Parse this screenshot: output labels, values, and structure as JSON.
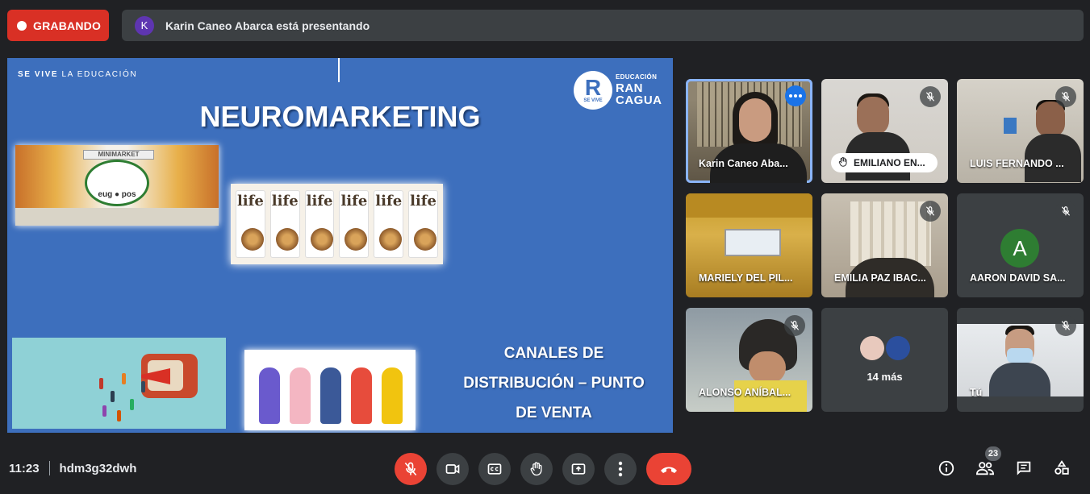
{
  "recording": {
    "label": "GRABANDO"
  },
  "presenter": {
    "initial": "K",
    "text": "Karin Caneo Abarca está presentando"
  },
  "slide": {
    "tagline_bold": "SE VIVE",
    "tagline_rest": " LA EDUCACIÓN",
    "title": "NEUROMARKETING",
    "logo_letter": "R",
    "logo_small": "SE VIVE",
    "logo_line1": "EDUCACIÓN",
    "logo_line2": "RAN",
    "logo_line3": "CAGUA",
    "minimarket_sign": "MINIMARKET",
    "minimarket_brand": "eug ● pos",
    "life_brand": "life",
    "canales_line1": "CANALES DE",
    "canales_line2": "DISTRIBUCIÓN – PUNTO",
    "canales_line3": "DE VENTA"
  },
  "participants": [
    {
      "name": "Karin Caneo Aba...",
      "speaking": true,
      "menu": true
    },
    {
      "name": "EMILIANO EN...",
      "hand_raised": true,
      "muted": true
    },
    {
      "name": "LUIS FERNANDO ...",
      "muted": true
    },
    {
      "name": "MARIELY DEL PIL..."
    },
    {
      "name": "EMILIA PAZ IBAC...",
      "muted": true
    },
    {
      "name": "AARON DAVID SA...",
      "muted": true,
      "avatar": "A",
      "avatar_color": "#2e7d32"
    },
    {
      "name": "ALONSO ANÍBAL...",
      "muted": true
    },
    {
      "name": "14 más"
    },
    {
      "name": "Tú",
      "muted": true
    }
  ],
  "meeting": {
    "time": "11:23",
    "code": "hdm3g32dwh",
    "participant_count": "23"
  },
  "colors": {
    "accent": "#1a73e8",
    "danger": "#ea4335",
    "speaking_outline": "#8ab4f8",
    "background": "#202124"
  },
  "controls": [
    "mic-off-icon",
    "camera-icon",
    "captions-icon",
    "raise-hand-icon",
    "present-icon",
    "more-options-icon",
    "end-call-icon"
  ],
  "right_controls": [
    "info-icon",
    "people-icon",
    "chat-icon",
    "activities-icon"
  ]
}
